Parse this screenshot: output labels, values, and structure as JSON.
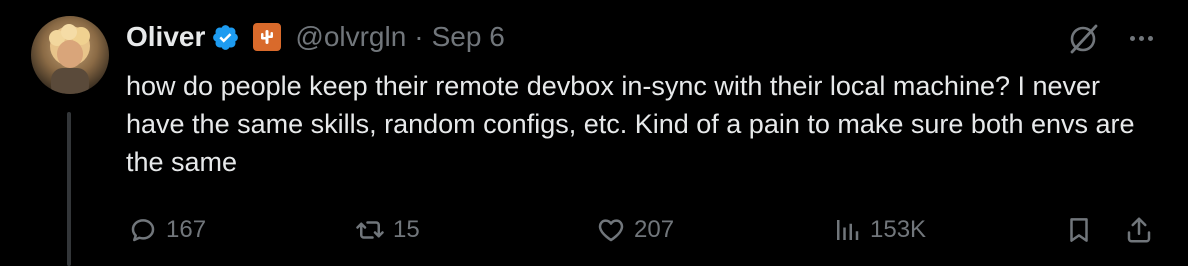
{
  "tweet": {
    "author_name": "Oliver",
    "handle": "@olvrgln",
    "separator": "·",
    "date": "Sep 6",
    "text": "how do people keep their remote devbox in-sync with their local machine? I never have the same skills, random configs, etc. Kind of a pain to make sure both envs are the same"
  },
  "icons": {
    "verified": "verified-badge-icon",
    "affiliate": "cactus-affiliate-icon",
    "grok": "grok-icon",
    "more": "more-dots-icon",
    "reply": "reply-icon",
    "retweet": "retweet-icon",
    "like": "heart-icon",
    "views": "views-bar-chart-icon",
    "bookmark": "bookmark-icon",
    "share": "share-icon"
  },
  "actions": {
    "reply_count": "167",
    "retweet_count": "15",
    "like_count": "207",
    "views_count": "153K"
  },
  "colors": {
    "background": "#000000",
    "text_primary": "#e7e9ea",
    "text_secondary": "#71767b",
    "verified_blue": "#1d9bf0",
    "affiliate_orange": "#d96a2b"
  }
}
